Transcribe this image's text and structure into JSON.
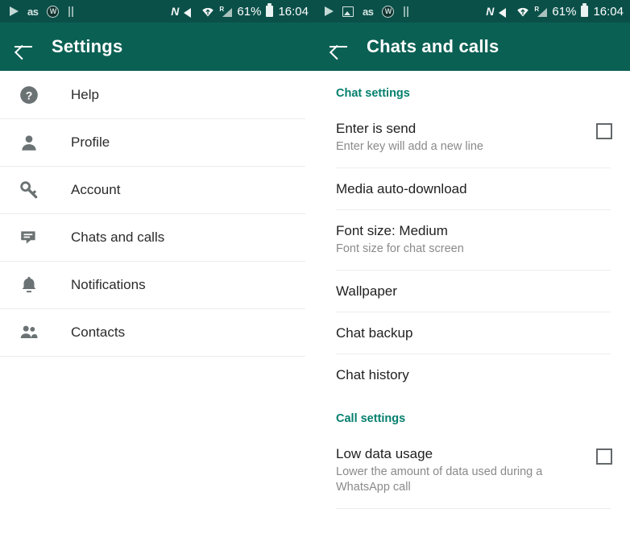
{
  "status_bar": {
    "left_panel_icons": [
      "play-icon",
      "lastfm-icon",
      "w-badge-icon",
      "pause-icon"
    ],
    "right_panel_icons": [
      "play-icon",
      "screenshot-image-icon",
      "lastfm-icon",
      "w-badge-icon",
      "pause-icon"
    ],
    "lastfm_label": "as",
    "w_badge_label": "W",
    "nfc_label": "N",
    "roaming_label": "R",
    "battery_percent": "61%",
    "time": "16:04",
    "right_icons": [
      "nfc-icon",
      "mute-icon",
      "wifi-icon",
      "signal-roaming-icon",
      "battery-icon"
    ],
    "wifi_glyph": "▲"
  },
  "colors": {
    "status_bar_bg": "#0a5049",
    "app_bar_bg": "#0b6054",
    "section_header_teal": "#047f6d",
    "divider": "#ececec",
    "primary_text": "#2b2b2b",
    "secondary_text": "#8a8a8a",
    "icon_gray": "#6b7273"
  },
  "left_screen": {
    "app_bar": {
      "back_icon": "back-arrow-icon",
      "title": "Settings"
    },
    "items": [
      {
        "icon": "help-circle-icon",
        "label": "Help"
      },
      {
        "icon": "person-icon",
        "label": "Profile"
      },
      {
        "icon": "key-icon",
        "label": "Account"
      },
      {
        "icon": "chat-bubble-icon",
        "label": "Chats and calls"
      },
      {
        "icon": "bell-icon",
        "label": "Notifications"
      },
      {
        "icon": "contacts-people-icon",
        "label": "Contacts"
      }
    ]
  },
  "right_screen": {
    "app_bar": {
      "back_icon": "back-arrow-icon",
      "title": "Chats and calls"
    },
    "sections": [
      {
        "title": "Chat settings",
        "rows": [
          {
            "title": "Enter is send",
            "subtitle": "Enter key will add a new line",
            "control": "checkbox",
            "checked": false
          },
          {
            "title": "Media auto-download",
            "subtitle": "",
            "control": "none"
          },
          {
            "title": "Font size: Medium",
            "subtitle": "Font size for chat screen",
            "control": "none"
          },
          {
            "title": "Wallpaper",
            "subtitle": "",
            "control": "none"
          },
          {
            "title": "Chat backup",
            "subtitle": "",
            "control": "none"
          },
          {
            "title": "Chat history",
            "subtitle": "",
            "control": "none"
          }
        ]
      },
      {
        "title": "Call settings",
        "rows": [
          {
            "title": "Low data usage",
            "subtitle": "Lower the amount of data used during a WhatsApp call",
            "control": "checkbox",
            "checked": false
          }
        ]
      }
    ]
  }
}
